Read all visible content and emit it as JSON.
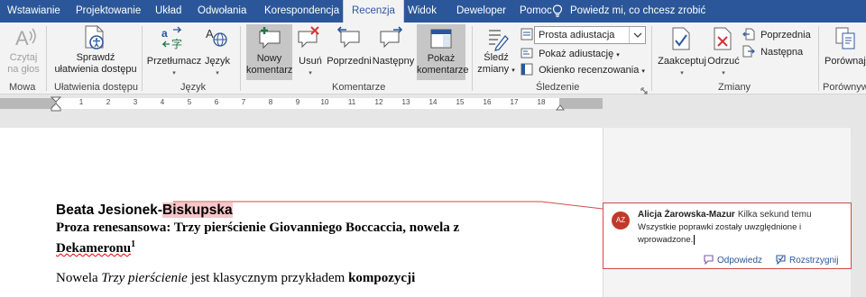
{
  "tabs": [
    "Wstawianie",
    "Projektowanie",
    "Układ",
    "Odwołania",
    "Korespondencja",
    "Recenzja",
    "Widok",
    "Deweloper",
    "Pomoc"
  ],
  "active_tab": "Recenzja",
  "tell_me": "Powiedz mi, co chcesz zrobić",
  "ribbon": {
    "speech": {
      "read_aloud_1": "Czytaj",
      "read_aloud_2": "na głos",
      "group": "Mowa"
    },
    "accessibility": {
      "check_1": "Sprawdź",
      "check_2": "ułatwienia dostępu",
      "group": "Ułatwienia dostępu"
    },
    "language": {
      "translate": "Przetłumacz",
      "language": "Język",
      "group": "Język"
    },
    "comments": {
      "new_1": "Nowy",
      "new_2": "komentarz",
      "delete": "Usuń",
      "previous": "Poprzedni",
      "next": "Następny",
      "show_1": "Pokaż",
      "show_2": "komentarze",
      "group": "Komentarze"
    },
    "tracking": {
      "track_1": "Śledź",
      "track_2": "zmiany",
      "markup_select": "Prosta adiustacja",
      "show_markup": "Pokaż adiustację",
      "reviewing_pane": "Okienko recenzowania",
      "group": "Śledzenie"
    },
    "changes": {
      "accept": "Zaakceptuj",
      "reject": "Odrzuć",
      "previous": "Poprzednia",
      "next": "Następna",
      "group": "Zmiany"
    },
    "compare": {
      "compare": "Porównaj",
      "group": "Porównywa"
    }
  },
  "ruler_numbers": [
    "1",
    "2",
    "3",
    "4",
    "5",
    "6",
    "7",
    "8",
    "9",
    "10",
    "11",
    "12",
    "13",
    "14",
    "15",
    "16",
    "17",
    "18"
  ],
  "document": {
    "author_first": "Beata Jesionek-",
    "author_highlight": "Biskupska",
    "subtitle_line1": "Proza renesansowa: Trzy pierścienie Giovanniego Boccaccia, nowela z",
    "subtitle_line2_word": "Dekameronu",
    "subtitle_line2_sup": "1",
    "body_start": "Nowela ",
    "body_italic": "Trzy pierścienie",
    "body_mid": " jest klasycznym przykładem ",
    "body_bold": "kompozycji"
  },
  "comment": {
    "initials": "AZ",
    "author": "Alicja Żarowska-Mazur",
    "time": "Kilka sekund temu",
    "text_line1": "Wszystkie poprawki zostały uwzględnione i",
    "text_line2": "wprowadzone.",
    "reply": "Odpowiedz",
    "resolve": "Rozstrzygnij"
  },
  "colors": {
    "accent": "#2b579a",
    "comment_border": "#d24a4a",
    "avatar": "#c0392b",
    "highlight": "#f4c7c9"
  }
}
